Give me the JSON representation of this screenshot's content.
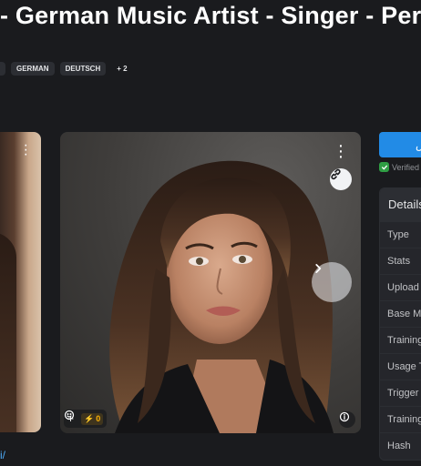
{
  "page": {
    "title": "- German Music Artist - Singer - Perf",
    "tags": [
      "GERMAN",
      "DEUTSCH"
    ],
    "more_tags": "+ 2",
    "bottom_link": "i/"
  },
  "image": {
    "buzz_count": "0"
  },
  "sidebar": {
    "download_label": "س",
    "verified_label": "Verified",
    "details_title": "Details",
    "rows": [
      "Type",
      "Stats",
      "Upload",
      "Base M",
      "Training",
      "Usage T",
      "Trigger",
      "Training",
      "Hash"
    ]
  },
  "colors": {
    "background": "#1a1b1e",
    "accent": "#228be6",
    "buzz": "#fab005",
    "verified": "#2f9e44",
    "link": "#4dabf7"
  },
  "icons": [
    "more-vertical-icon",
    "link-icon",
    "chevron-right-icon",
    "plus-icon",
    "smile-icon",
    "bolt-icon",
    "info-icon",
    "check-icon"
  ]
}
